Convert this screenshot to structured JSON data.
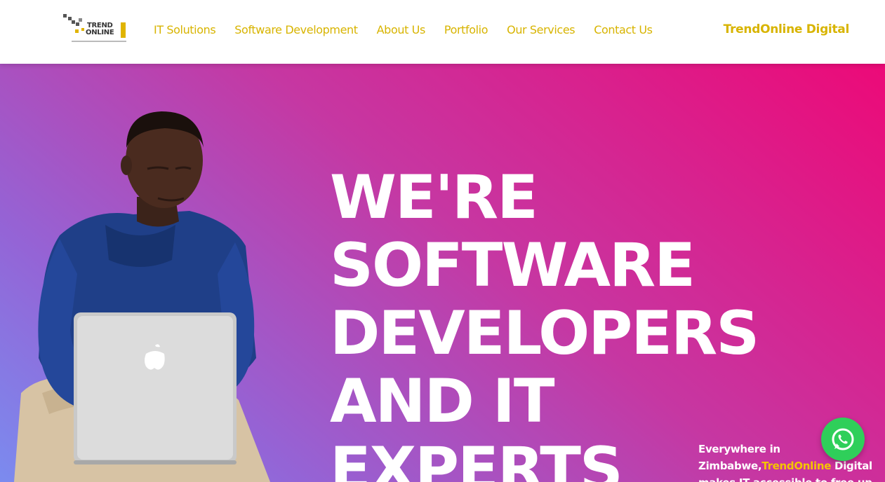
{
  "header": {
    "logo": {
      "line1": "TREND",
      "line2": "ONLINE"
    },
    "nav": [
      {
        "label": "IT Solutions"
      },
      {
        "label": "Software Development"
      },
      {
        "label": "About Us"
      },
      {
        "label": "Portfolio"
      },
      {
        "label": "Our Services"
      },
      {
        "label": "Contact Us"
      }
    ],
    "brand": "TrendOnline Digital"
  },
  "hero": {
    "headline": [
      "WE'RE",
      "SOFTWARE",
      "DEVELOPERS",
      "AND IT",
      "EXPERTS"
    ],
    "subtext": {
      "line1": "Everywhere in",
      "line2_start": "Zimbabwe,",
      "line2_highlight": "TrendOnline",
      "line2_end": " Digital",
      "line3": "makes IT accessible to free up"
    }
  },
  "colors": {
    "accent": "#d8b400",
    "gradient_start": "#ec0a78",
    "gradient_end": "#7b8bef",
    "whatsapp": "#2fcf5a"
  },
  "icons": {
    "whatsapp": "whatsapp-icon",
    "laptop_logo": "apple-icon"
  }
}
